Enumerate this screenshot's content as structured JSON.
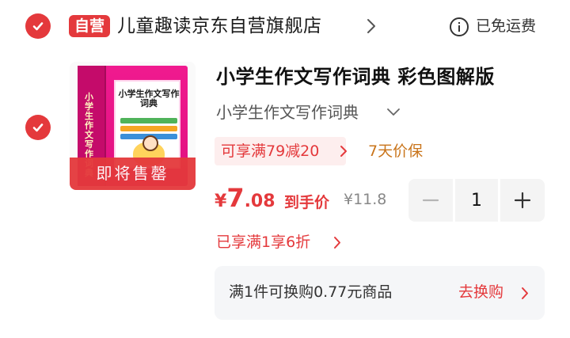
{
  "shop": {
    "badge": "自营",
    "name": "儿童趣读京东自营旗舰店",
    "shipping": "已免运费"
  },
  "product": {
    "title": "小学生作文写作词典 彩色图解版",
    "variant": "小学生作文写作词典",
    "image_overlay": "即将售罄",
    "book_cover_title": "小学生作文写作词典",
    "book_spine_text": "小学生作文写作词典",
    "coupon": "可享满79减20",
    "price_protect": "7天价保",
    "price": {
      "symbol": "¥",
      "integer": "7",
      "decimal": ".08",
      "label": "到手价",
      "original": "¥11.8"
    },
    "quantity": "1",
    "promo": "已享满1享6折",
    "swap": {
      "text": "满1件可换购0.77元商品",
      "link": "去换购"
    }
  },
  "colors": {
    "accent": "#e4393c",
    "price_protect": "#c9741a",
    "book_cover": "#e0107f"
  }
}
